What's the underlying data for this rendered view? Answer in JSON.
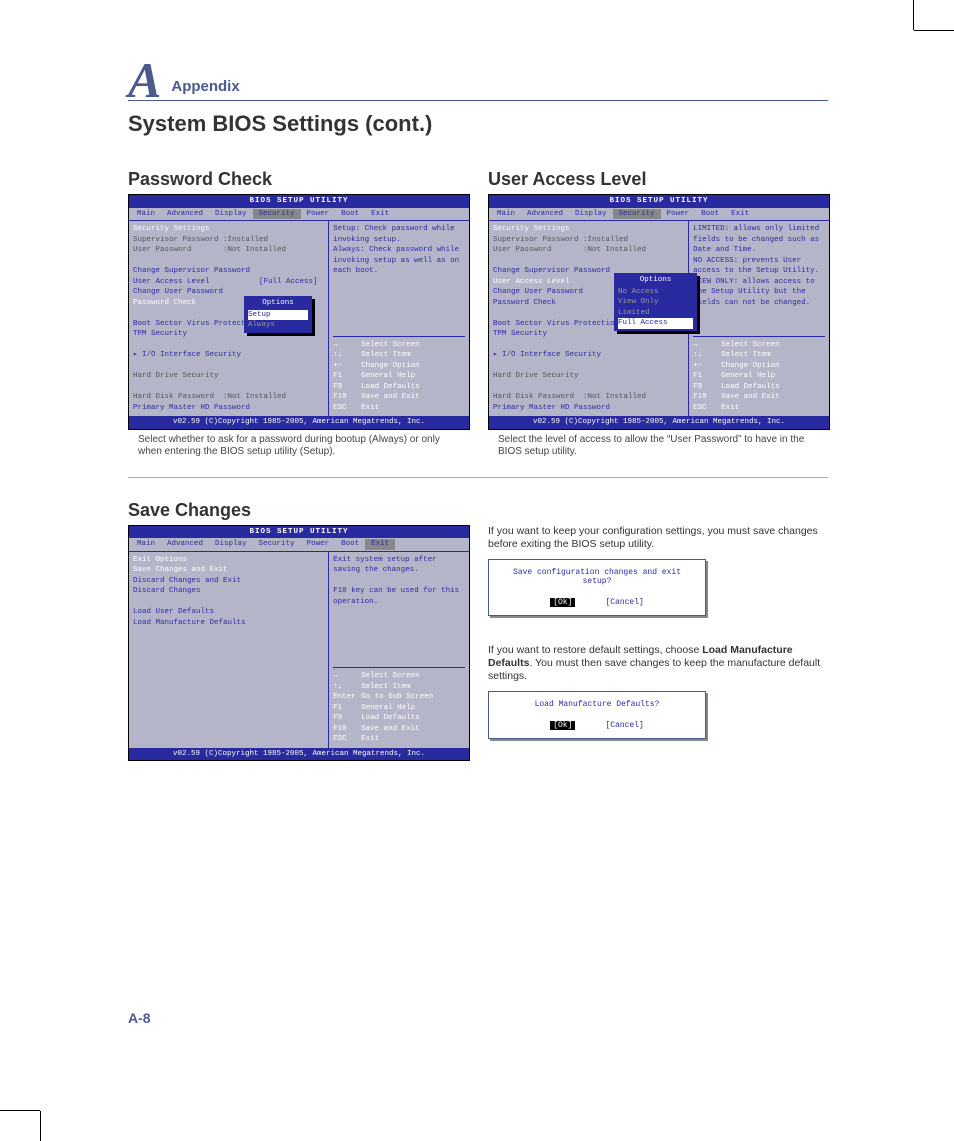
{
  "header": {
    "letter": "A",
    "label": "Appendix"
  },
  "title": "System BIOS Settings (cont.)",
  "page_number": "A-8",
  "bios_common": {
    "title": "BIOS SETUP UTILITY",
    "menus": [
      "Main",
      "Advanced",
      "Display",
      "Security",
      "Power",
      "Boot",
      "Exit"
    ],
    "footer": "v02.59 (C)Copyright 1985-2005, American Megatrends, Inc.",
    "nav": [
      [
        "↔",
        "Select Screen"
      ],
      [
        "↑↓",
        "Select Item"
      ],
      [
        "+-",
        "Change Option"
      ],
      [
        "F1",
        "General Help"
      ],
      [
        "F9",
        "Load Defaults"
      ],
      [
        "F10",
        "Save and Exit"
      ],
      [
        "ESC",
        "Exit"
      ]
    ],
    "nav_exit": [
      [
        "↔",
        "Select Screen"
      ],
      [
        "↑↓",
        "Select Item"
      ],
      [
        "Enter",
        "Go to Sub Screen"
      ],
      [
        "F1",
        "General Help"
      ],
      [
        "F9",
        "Load Defaults"
      ],
      [
        "F10",
        "Save and Exit"
      ],
      [
        "ESC",
        "Exit"
      ]
    ]
  },
  "password_check": {
    "heading": "Password Check",
    "selected_menu": "Security",
    "left_title": "Security Settings",
    "lines": [
      {
        "t": "Supervisor Password :Installed",
        "c": "grey"
      },
      {
        "t": "User Password       :Not Installed",
        "c": "grey"
      },
      {
        "t": "",
        "c": ""
      },
      {
        "t": "Change Supervisor Password",
        "c": "blue"
      },
      {
        "t": "User Access Level           [Full Access]",
        "c": "blue"
      },
      {
        "t": "Change User Password",
        "c": "blue"
      },
      {
        "t": "Password Check",
        "c": "white"
      },
      {
        "t": "",
        "c": ""
      },
      {
        "t": "Boot Sector Virus Protectio",
        "c": "blue"
      },
      {
        "t": "TPM Security",
        "c": "blue"
      },
      {
        "t": "",
        "c": ""
      },
      {
        "t": "▸ I/O Interface Security",
        "c": "blue"
      },
      {
        "t": "",
        "c": ""
      },
      {
        "t": "Hard Drive Security",
        "c": "grey"
      },
      {
        "t": "",
        "c": ""
      },
      {
        "t": "Hard Disk Password  :Not Installed",
        "c": "grey"
      },
      {
        "t": "Primary Master HD Password",
        "c": "blue"
      }
    ],
    "popup": {
      "title": "Options",
      "options": [
        "Setup",
        "Always"
      ],
      "selected": "Setup"
    },
    "help": "Setup: Check password while invoking setup.\nAlways: Check password while invoking setup as well as on each boot.",
    "caption": "Select whether to ask for a password during bootup (Always) or only when entering the BIOS setup utility (Setup)."
  },
  "user_access": {
    "heading": "User Access Level",
    "selected_menu": "Security",
    "left_title": "Security Settings",
    "lines": [
      {
        "t": "Supervisor Password :Installed",
        "c": "grey"
      },
      {
        "t": "User Password       :Not Installed",
        "c": "grey"
      },
      {
        "t": "",
        "c": ""
      },
      {
        "t": "Change Supervisor Password",
        "c": "blue"
      },
      {
        "t": "User Access Level           [Full Access]",
        "c": "white"
      },
      {
        "t": "Change User Password",
        "c": "blue"
      },
      {
        "t": "Password Check",
        "c": "blue"
      },
      {
        "t": "",
        "c": ""
      },
      {
        "t": "Boot Sector Virus Protectio",
        "c": "blue"
      },
      {
        "t": "TPM Security",
        "c": "blue"
      },
      {
        "t": "",
        "c": ""
      },
      {
        "t": "▸ I/O Interface Security",
        "c": "blue"
      },
      {
        "t": "",
        "c": ""
      },
      {
        "t": "Hard Drive Security",
        "c": "grey"
      },
      {
        "t": "",
        "c": ""
      },
      {
        "t": "Hard Disk Password  :Not Installed",
        "c": "grey"
      },
      {
        "t": "Primary Master HD Password",
        "c": "blue"
      }
    ],
    "popup": {
      "title": "Options",
      "options": [
        "No Access",
        "View Only",
        "Limited",
        "Full Access"
      ],
      "selected": "Full Access"
    },
    "help": "LIMITED: allows only limited fields to be changed such as Date and Time.\nNO ACCESS: prevents User access to the Setup Utility.\nVIEW ONLY: allows access to the Setup Utility but the fields can not be changed.",
    "caption": "Select the level of access to allow the “User Password” to have in the BIOS setup utility."
  },
  "save_changes": {
    "heading": "Save Changes",
    "selected_menu": "Exit",
    "left_title": "Exit Options",
    "lines": [
      {
        "t": "Save Changes and Exit",
        "c": "white"
      },
      {
        "t": "Discard Changes and Exit",
        "c": "blue"
      },
      {
        "t": "Discard Changes",
        "c": "blue"
      },
      {
        "t": "",
        "c": ""
      },
      {
        "t": "Load User Defaults",
        "c": "blue"
      },
      {
        "t": "Load Manufacture Defaults",
        "c": "blue"
      }
    ],
    "help": "Exit system setup after saving the changes.\n\nF10 key can be used for this operation.",
    "text1": "If you want to keep your configuration settings, you must save changes before exiting the BIOS setup utility.",
    "dialog1": {
      "msg": "Save configuration changes and exit setup?",
      "ok": "[Ok]",
      "cancel": "[Cancel]"
    },
    "text2_pre": "If you want to restore default settings, choose ",
    "text2_bold": "Load Manufacture Defaults",
    "text2_post": ". You must then save changes to keep the manufacture default settings.",
    "dialog2": {
      "msg": "Load Manufacture Defaults?",
      "ok": "[Ok]",
      "cancel": "[Cancel]"
    }
  }
}
